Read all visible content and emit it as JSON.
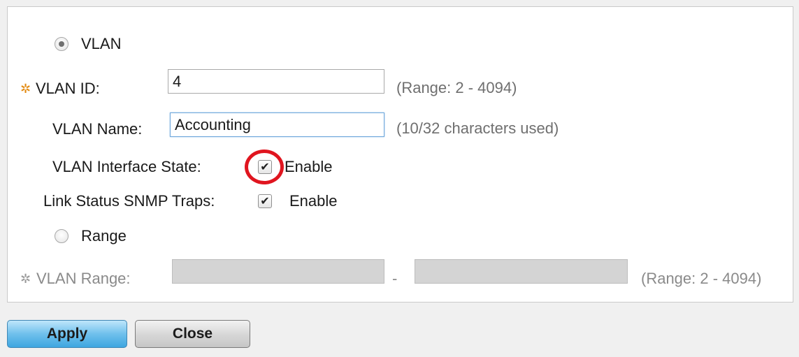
{
  "form": {
    "vlan_radio": {
      "label": "VLAN",
      "selected": true
    },
    "vlan_id": {
      "label": "VLAN ID:",
      "value": "4",
      "hint": "(Range: 2 - 4094)"
    },
    "vlan_name": {
      "label": "VLAN Name:",
      "value": "Accounting",
      "hint": "(10/32 characters used)"
    },
    "interface_state": {
      "label": "VLAN Interface State:",
      "checked": true,
      "checkbox_label": "Enable",
      "check_mark": "✔"
    },
    "snmp_traps": {
      "label": "Link Status SNMP Traps:",
      "checked": true,
      "checkbox_label": "Enable",
      "check_mark": "✔"
    },
    "range_radio": {
      "label": "Range",
      "selected": false
    },
    "vlan_range": {
      "label": "VLAN Range:",
      "from_value": "",
      "to_value": "",
      "separator": "-",
      "hint": "(Range: 2 - 4094)"
    },
    "required_icon": "✲"
  },
  "buttons": {
    "apply_label": "Apply",
    "close_label": "Close"
  },
  "colors": {
    "required_star": "#e38b12",
    "highlight_ring": "#e0151f",
    "apply_button": "#6fc0ec"
  }
}
